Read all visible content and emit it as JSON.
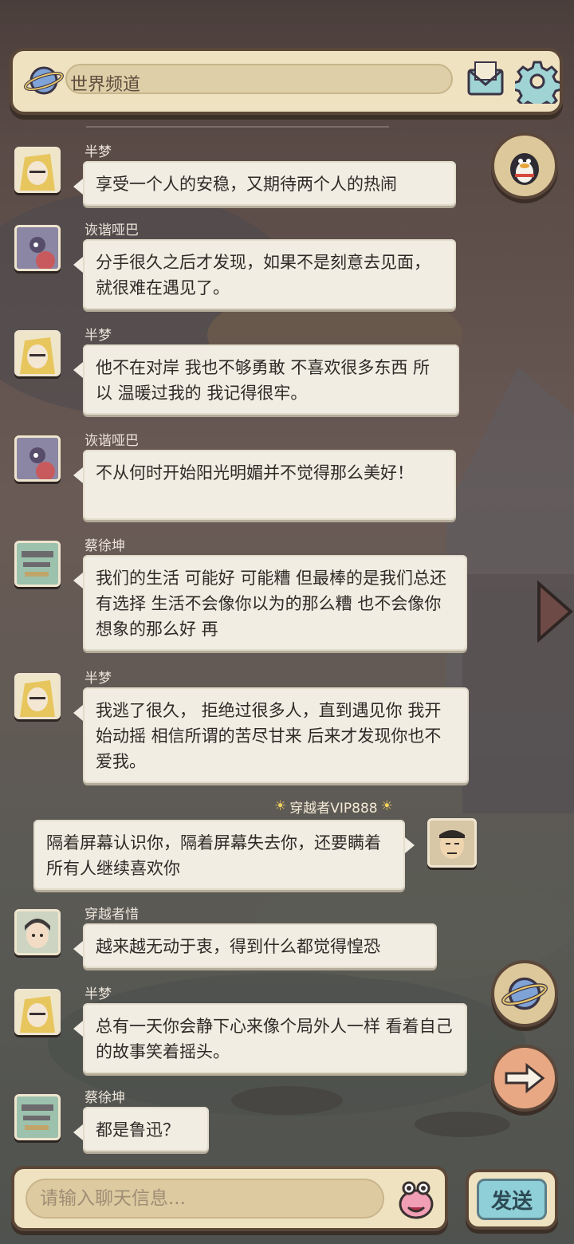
{
  "header": {
    "channel_label": "世界频道"
  },
  "messages": [
    {
      "sender": "半梦",
      "text": "享受一个人的安稳，又期待两个人的热闹"
    },
    {
      "sender": "诙谐哑巴",
      "text": "分手很久之后才发现，如果不是刻意去见面，就很难在遇见了。"
    },
    {
      "sender": "半梦",
      "text": "他不在对岸  我也不够勇敢  不喜欢很多东西  所以  温暖过我的  我记得很牢。"
    },
    {
      "sender": "诙谐哑巴",
      "text": "不从何时开始阳光明媚并不觉得那么美好！"
    },
    {
      "sender": "蔡徐坤",
      "text": "我们的生活  可能好  可能糟  但最棒的是我们总还有选择  生活不会像你以为的那么糟  也不会像你想象的那么好  再"
    },
    {
      "sender": "半梦",
      "text": "我逃了很久，  拒绝过很多人，直到遇见你  我开始动摇  相信所谓的苦尽甘来  后来才发现你也不爱我。"
    },
    {
      "sender": "穿越者VIP888",
      "text": "隔着屏幕认识你，隔着屏幕失去你，还要瞒着所有人继续喜欢你"
    },
    {
      "sender": "穿越者惜",
      "text": "越来越无动于衷，得到什么都觉得惶恐"
    },
    {
      "sender": "半梦",
      "text": "总有一天你会静下心来像个局外人一样  看着自己的故事笑着摇头。"
    },
    {
      "sender": "蔡徐坤",
      "text": "都是鲁迅？"
    }
  ],
  "input": {
    "placeholder": "请输入聊天信息..."
  },
  "send_label": "发送",
  "icons": {
    "planet": "planet-icon",
    "mail": "mail-icon",
    "settings": "gear-icon",
    "penguin": "penguin-icon",
    "arrow": "arrow-right-icon",
    "emoji": "emoji-face-icon"
  },
  "colors": {
    "panel": "#efe2c0",
    "border": "#5a4738",
    "bubble": "#f1ede3",
    "send": "#8fcfd7"
  }
}
